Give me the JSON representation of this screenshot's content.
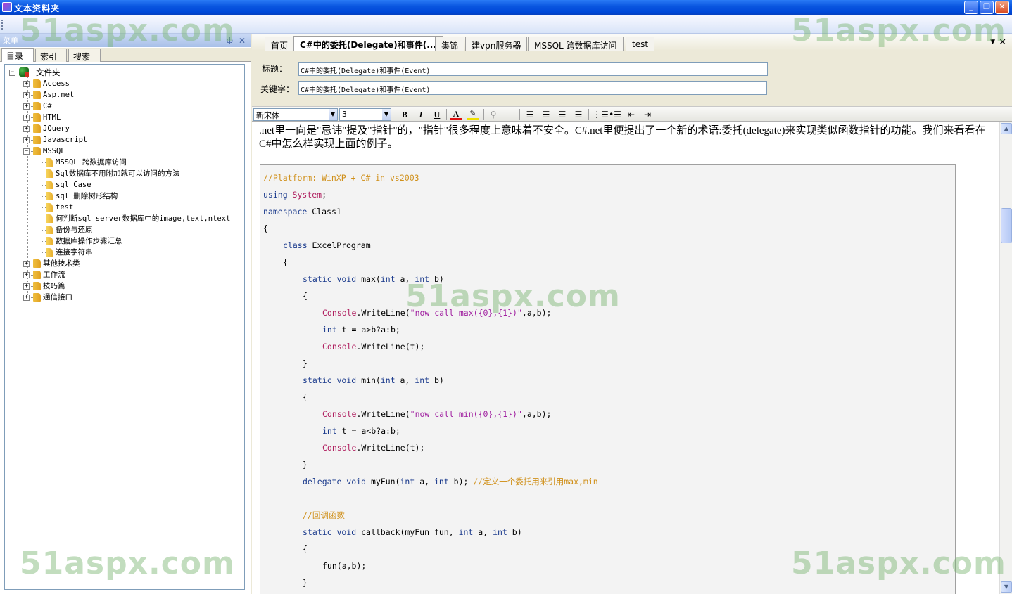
{
  "window": {
    "title": "文本资料夹"
  },
  "watermark": "51aspx.com",
  "left_panel": {
    "header": "菜单",
    "pin_glyph": "ф",
    "close_glyph": "✕",
    "tabs": [
      "目录",
      "索引",
      "搜索"
    ],
    "tree": {
      "root": "文件夹",
      "items": [
        {
          "label": "Access",
          "type": "folder",
          "expanded": false
        },
        {
          "label": "Asp.net",
          "type": "folder",
          "expanded": false
        },
        {
          "label": "C#",
          "type": "folder",
          "expanded": false
        },
        {
          "label": "HTML",
          "type": "folder",
          "expanded": false
        },
        {
          "label": "JQuery",
          "type": "folder",
          "expanded": false
        },
        {
          "label": "Javascript",
          "type": "folder",
          "expanded": false
        },
        {
          "label": "MSSQL",
          "type": "folder",
          "expanded": true
        },
        {
          "label": "MSSQL 跨数据库访问",
          "type": "leaf"
        },
        {
          "label": "Sql数据库不用附加就可以访问的方法",
          "type": "leaf"
        },
        {
          "label": "sql Case",
          "type": "leaf"
        },
        {
          "label": "sql 删除树形结构",
          "type": "leaf"
        },
        {
          "label": "test",
          "type": "leaf"
        },
        {
          "label": "何判断sql server数据库中的image,text,ntext",
          "type": "leaf"
        },
        {
          "label": "备份与还原",
          "type": "leaf"
        },
        {
          "label": "数据库操作步骤汇总",
          "type": "leaf"
        },
        {
          "label": "连接字符串",
          "type": "leaf"
        },
        {
          "label": "其他技术类",
          "type": "folder",
          "expanded": false
        },
        {
          "label": "工作流",
          "type": "folder",
          "expanded": false
        },
        {
          "label": "技巧篇",
          "type": "folder",
          "expanded": false
        },
        {
          "label": "通信接口",
          "type": "folder",
          "expanded": false
        }
      ]
    }
  },
  "doc_tabs": [
    "首页",
    "C#中的委托(Delegate)和事件(...",
    "集锦",
    "建vpn服务器",
    "MSSQL 跨数据库访问",
    "test"
  ],
  "active_tab": 1,
  "form": {
    "title_label": "标题：",
    "title_value": "C#中的委托(Delegate)和事件(Event)",
    "keyword_label": "关键字：",
    "keyword_value": "C#中的委托(Delegate)和事件(Event)"
  },
  "editor_toolbar": {
    "font": "新宋体",
    "size": "3",
    "bold": "B",
    "italic": "I",
    "underline": "U"
  },
  "content": {
    "intro": " .net里一向是\"忌讳\"提及\"指针\"的，\"指针\"很多程度上意味着不安全。C#.net里便提出了一个新的术语:委托(delegate)来实现类似函数指针的功能。我们来看看在C#中怎么样实现上面的例子。",
    "code": [
      {
        "indent": 0,
        "parts": [
          {
            "t": "//Platform: WinXP + C# in vs2003",
            "c": "cm"
          }
        ]
      },
      {
        "indent": 0,
        "parts": [
          {
            "t": "using ",
            "c": "kw"
          },
          {
            "t": "System",
            "c": "cls"
          },
          {
            "t": ";",
            "c": ""
          }
        ]
      },
      {
        "indent": 0,
        "parts": [
          {
            "t": "namespace ",
            "c": "kw"
          },
          {
            "t": "Class1",
            "c": ""
          }
        ]
      },
      {
        "indent": 0,
        "parts": [
          {
            "t": "{",
            "c": ""
          }
        ]
      },
      {
        "indent": 1,
        "parts": [
          {
            "t": "class ",
            "c": "kw"
          },
          {
            "t": "ExcelProgram",
            "c": ""
          }
        ]
      },
      {
        "indent": 1,
        "parts": [
          {
            "t": "{",
            "c": ""
          }
        ]
      },
      {
        "indent": 2,
        "parts": [
          {
            "t": "static void ",
            "c": "kw"
          },
          {
            "t": "max(",
            "c": ""
          },
          {
            "t": "int ",
            "c": "kw"
          },
          {
            "t": "a, ",
            "c": ""
          },
          {
            "t": "int ",
            "c": "kw"
          },
          {
            "t": "b)",
            "c": ""
          }
        ]
      },
      {
        "indent": 2,
        "parts": [
          {
            "t": "{",
            "c": ""
          }
        ]
      },
      {
        "indent": 3,
        "parts": [
          {
            "t": "Console",
            "c": "cls"
          },
          {
            "t": ".WriteLine(",
            "c": ""
          },
          {
            "t": "\"now call max({0},{1})\"",
            "c": "str"
          },
          {
            "t": ",a,b);",
            "c": ""
          }
        ]
      },
      {
        "indent": 3,
        "parts": [
          {
            "t": "int ",
            "c": "kw"
          },
          {
            "t": "t = a>b?a:b;",
            "c": ""
          }
        ]
      },
      {
        "indent": 3,
        "parts": [
          {
            "t": "Console",
            "c": "cls"
          },
          {
            "t": ".WriteLine(t);",
            "c": ""
          }
        ]
      },
      {
        "indent": 2,
        "parts": [
          {
            "t": "}",
            "c": ""
          }
        ]
      },
      {
        "indent": 2,
        "parts": [
          {
            "t": "static void ",
            "c": "kw"
          },
          {
            "t": "min(",
            "c": ""
          },
          {
            "t": "int ",
            "c": "kw"
          },
          {
            "t": "a, ",
            "c": ""
          },
          {
            "t": "int ",
            "c": "kw"
          },
          {
            "t": "b)",
            "c": ""
          }
        ]
      },
      {
        "indent": 2,
        "parts": [
          {
            "t": "{",
            "c": ""
          }
        ]
      },
      {
        "indent": 3,
        "parts": [
          {
            "t": "Console",
            "c": "cls"
          },
          {
            "t": ".WriteLine(",
            "c": ""
          },
          {
            "t": "\"now call min({0},{1})\"",
            "c": "str"
          },
          {
            "t": ",a,b);",
            "c": ""
          }
        ]
      },
      {
        "indent": 3,
        "parts": [
          {
            "t": "int ",
            "c": "kw"
          },
          {
            "t": "t = a<b?a:b;",
            "c": ""
          }
        ]
      },
      {
        "indent": 3,
        "parts": [
          {
            "t": "Console",
            "c": "cls"
          },
          {
            "t": ".WriteLine(t);",
            "c": ""
          }
        ]
      },
      {
        "indent": 2,
        "parts": [
          {
            "t": "}",
            "c": ""
          }
        ]
      },
      {
        "indent": 2,
        "parts": [
          {
            "t": "delegate void ",
            "c": "kw"
          },
          {
            "t": "myFun(",
            "c": ""
          },
          {
            "t": "int ",
            "c": "kw"
          },
          {
            "t": "a, ",
            "c": ""
          },
          {
            "t": "int ",
            "c": "kw"
          },
          {
            "t": "b); ",
            "c": ""
          },
          {
            "t": "//定义一个委托用来引用max,min",
            "c": "cm"
          }
        ]
      },
      {
        "indent": 2,
        "parts": []
      },
      {
        "indent": 2,
        "parts": [
          {
            "t": "//回调函数",
            "c": "cm"
          }
        ]
      },
      {
        "indent": 2,
        "parts": [
          {
            "t": "static void ",
            "c": "kw"
          },
          {
            "t": "callback(myFun fun, ",
            "c": ""
          },
          {
            "t": "int ",
            "c": "kw"
          },
          {
            "t": "a, ",
            "c": ""
          },
          {
            "t": "int ",
            "c": "kw"
          },
          {
            "t": "b)",
            "c": ""
          }
        ]
      },
      {
        "indent": 2,
        "parts": [
          {
            "t": "{",
            "c": ""
          }
        ]
      },
      {
        "indent": 3,
        "parts": [
          {
            "t": "fun(a,b);",
            "c": ""
          }
        ]
      },
      {
        "indent": 2,
        "parts": [
          {
            "t": "}",
            "c": ""
          }
        ]
      }
    ]
  },
  "colors": {
    "comment": "#d0901a",
    "keyword": "#1a3a8c",
    "class": "#b02060",
    "string": "#a020a0",
    "titlebar": "#0a56e0"
  }
}
